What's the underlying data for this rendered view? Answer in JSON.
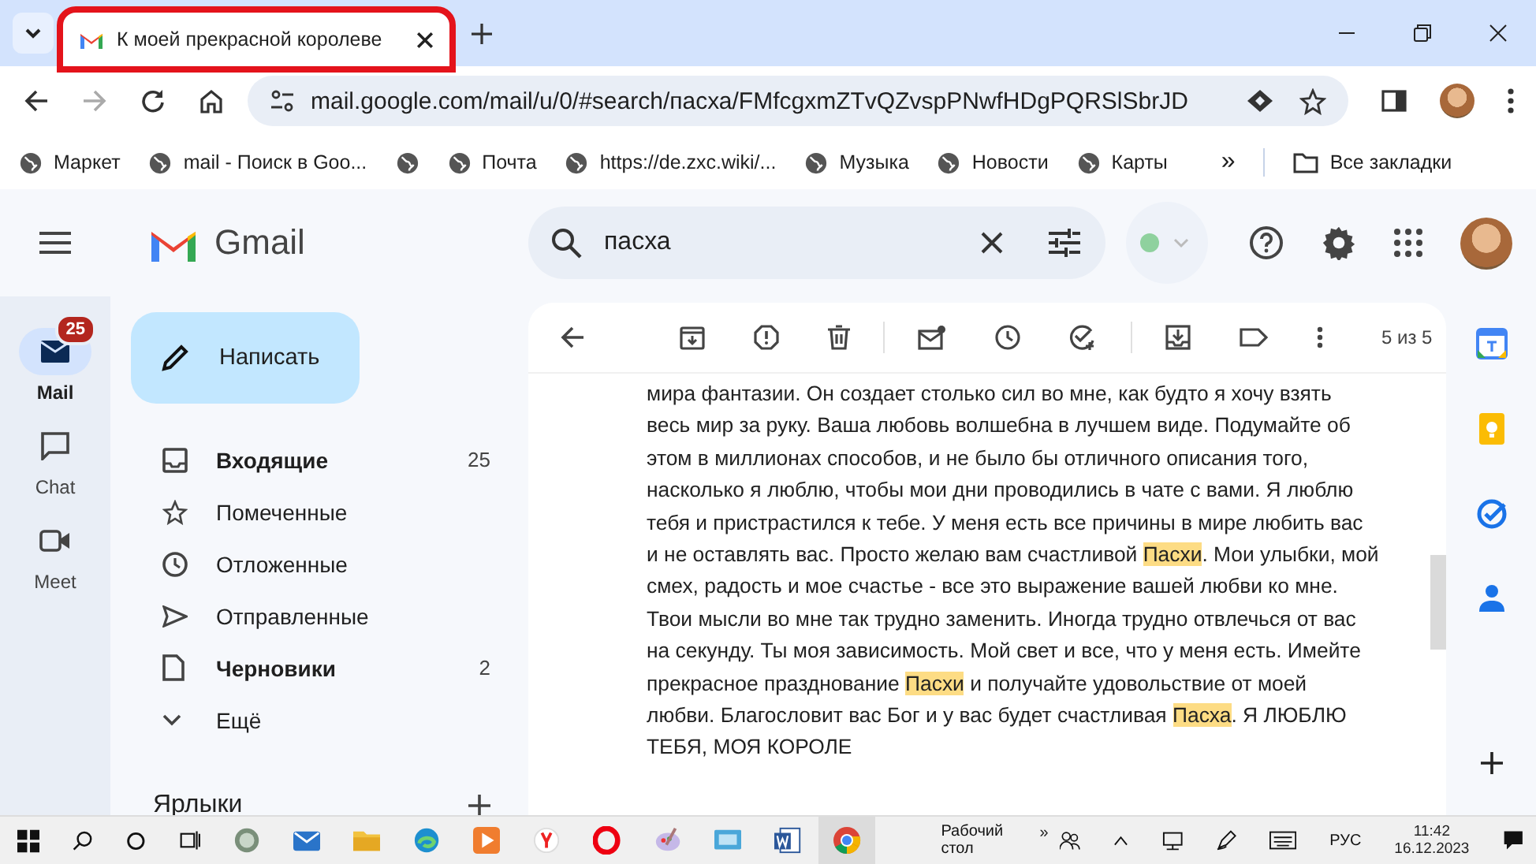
{
  "browser": {
    "tab": {
      "title": "К моей прекрасной королеве",
      "selected": true,
      "annotated": true
    },
    "url": "mail.google.com/mail/u/0/#search/пасха/FMfcgxmZTvQZvspPNwfHDgPQRSlSbrJD",
    "bookmarks": [
      {
        "kind": "link",
        "label": "Маркет"
      },
      {
        "kind": "link",
        "label": "mail - Поиск в Goo..."
      },
      {
        "kind": "icon"
      },
      {
        "kind": "link",
        "label": "Почта"
      },
      {
        "kind": "link",
        "label": "https://de.zxc.wiki/..."
      },
      {
        "kind": "link",
        "label": "Музыка"
      },
      {
        "kind": "link",
        "label": "Новости"
      },
      {
        "kind": "link",
        "label": "Карты"
      }
    ],
    "overflow": "»",
    "all_bookmarks": "Все закладки"
  },
  "gmail": {
    "logo": "Gmail",
    "search": {
      "value": "пасха"
    },
    "rail": [
      {
        "label": "Mail",
        "selected": true,
        "badge": "25"
      },
      {
        "label": "Chat",
        "selected": false
      },
      {
        "label": "Meet",
        "selected": false
      }
    ],
    "compose": "Написать",
    "nav": [
      {
        "label": "Входящие",
        "count": "25",
        "bold": true
      },
      {
        "label": "Помеченные",
        "bold": false
      },
      {
        "label": "Отложенные",
        "bold": false
      },
      {
        "label": "Отправленные",
        "bold": false
      },
      {
        "label": "Черновики",
        "count": "2",
        "bold": true
      },
      {
        "label": "Ещё",
        "bold": false
      }
    ],
    "labels_heading": "Ярлыки",
    "pager": "5 из 5",
    "body": [
      {
        "text": "мира фантазии. Он создает столько сил во мне, как будто я хочу взять весь мир за руку. Ваша любовь волшебна в лучшем виде. Подумайте об этом в миллионах способов, и не было бы отличного описания того, насколько я люблю, чтобы мои дни проводились в чате с вами. Я люблю тебя и пристрастился к тебе. У меня есть все причины в мире любить вас и не оставлять вас. Просто желаю вам счастливой ",
        "highlight": false
      },
      {
        "text": "Пасхи",
        "highlight": true
      },
      {
        "text": ". Мои улыбки, мой смех, радость и мое счастье - все это выражение вашей любви ко мне. Твои мысли во мне так трудно заменить. Иногда трудно отвлечься от вас на секунду. Ты моя зависимость. Мой свет и все, что у меня есть. Имейте прекрасное празднование ",
        "highlight": false
      },
      {
        "text": "Пасхи",
        "highlight": true
      },
      {
        "text": " и получайте удовольствие от моей любви. Благословит вас Бог и у вас будет счастливая ",
        "highlight": false
      },
      {
        "text": "Пасха",
        "highlight": true
      },
      {
        "text": ". Я ЛЮБЛЮ ТЕБЯ, МОЯ КОРОЛЕ",
        "highlight": false
      }
    ]
  },
  "taskbar": {
    "desktop": "Рабочий стол",
    "chevron": "»",
    "language": "РУС",
    "time": "11:42",
    "date": "16.12.2023"
  }
}
